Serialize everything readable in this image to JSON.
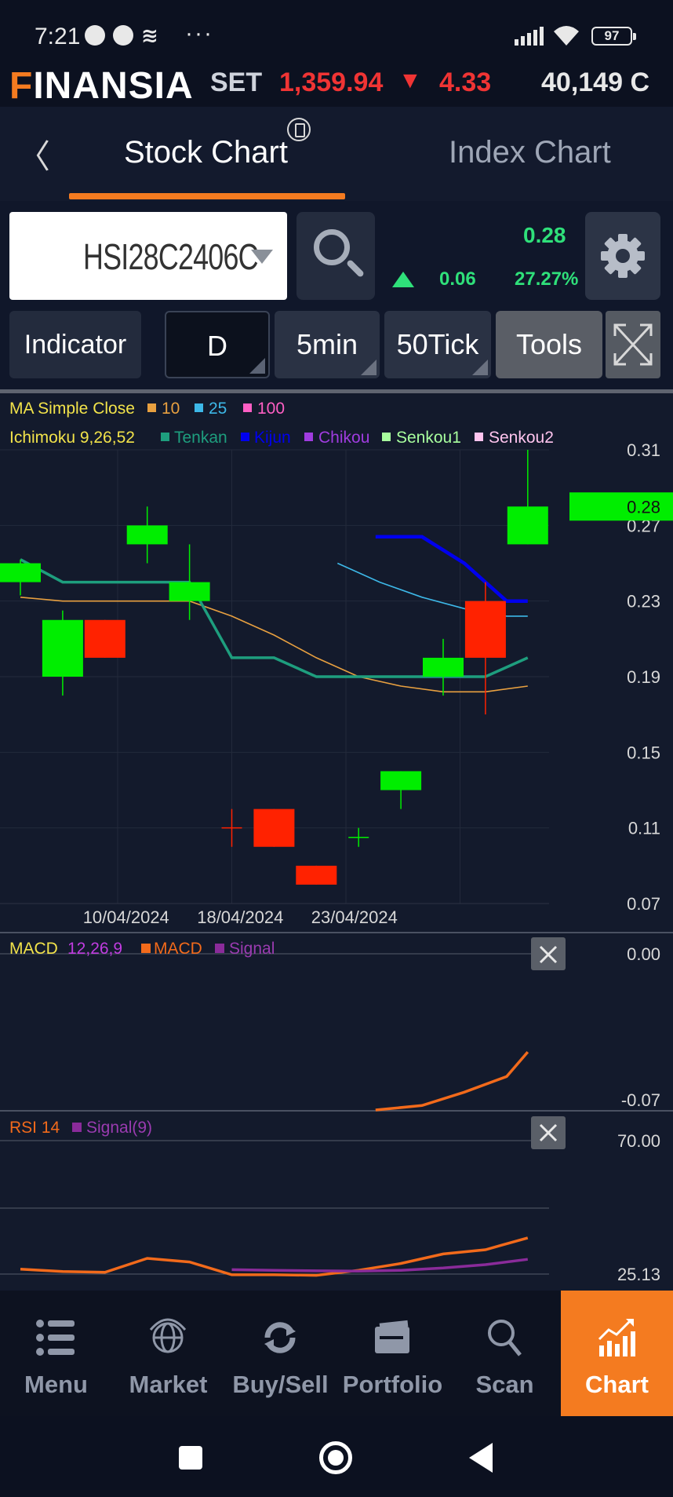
{
  "status_bar": {
    "time": "7:21",
    "icons": [
      "telegram-icon",
      "telegram-icon",
      "messenger-icon",
      "more-icon"
    ],
    "more": "···",
    "battery": "97"
  },
  "ticker": {
    "logo_first": "F",
    "logo_rest": "INANSIA",
    "market": "SET",
    "index": "1,359.94",
    "arrow": "▼",
    "change": "4.33",
    "volume": "40,149  C"
  },
  "tabs": {
    "back": "〈",
    "active": "Stock Chart",
    "inactive": "Index Chart"
  },
  "symbol": {
    "code": "HSI28C2406C",
    "last": "0.28",
    "change": "0.06",
    "percent": "27.27%"
  },
  "toolbar": {
    "indicator": "Indicator",
    "period_d": "D",
    "period_5min": "5min",
    "period_50tick": "50Tick",
    "tools": "Tools"
  },
  "colors": {
    "accent": "#f47b20",
    "up": "#00ee00",
    "down": "#ff2200",
    "tenkan": "#1e9e7e",
    "kijun": "#0000ee",
    "ma10": "#e8a040",
    "ma25": "#3db8e8",
    "macd": "#f26a1b",
    "signal": "#8a2b9a"
  },
  "chart_data": [
    {
      "type": "candlestick",
      "title": "",
      "legend_ma": {
        "name": "MA Simple Close",
        "items": [
          "10",
          "25",
          "100"
        ]
      },
      "legend_ichimoku": {
        "name": "Ichimoku 9,26,52",
        "items": [
          "Tenkan",
          "Kijun",
          "Chikou",
          "Senkou1",
          "Senkou2"
        ]
      },
      "x_ticks": [
        "10/04/2024",
        "18/04/2024",
        "23/04/2024"
      ],
      "y_ticks": [
        "0.31",
        "0.27",
        "0.23",
        "0.19",
        "0.15",
        "0.11",
        "0.07"
      ],
      "ylim": [
        0.07,
        0.31
      ],
      "last_price_label": "0.28",
      "candles": [
        {
          "o": 0.24,
          "c": 0.25,
          "h": 0.252,
          "l": 0.233
        },
        {
          "o": 0.19,
          "c": 0.22,
          "h": 0.225,
          "l": 0.18
        },
        {
          "o": 0.22,
          "c": 0.2,
          "h": 0.22,
          "l": 0.2
        },
        {
          "o": 0.26,
          "c": 0.27,
          "h": 0.28,
          "l": 0.25
        },
        {
          "o": 0.23,
          "c": 0.24,
          "h": 0.26,
          "l": 0.22
        },
        {
          "o": null,
          "c": null,
          "h": 0.12,
          "l": 0.1
        },
        {
          "o": 0.12,
          "c": 0.1,
          "h": 0.12,
          "l": 0.1
        },
        {
          "o": 0.09,
          "c": 0.08,
          "h": 0.09,
          "l": 0.08
        },
        {
          "o": null,
          "c": null,
          "h": 0.11,
          "l": 0.1
        },
        {
          "o": 0.13,
          "c": 0.14,
          "h": 0.14,
          "l": 0.12
        },
        {
          "o": 0.19,
          "c": 0.2,
          "h": 0.21,
          "l": 0.18
        },
        {
          "o": 0.23,
          "c": 0.2,
          "h": 0.24,
          "l": 0.17
        },
        {
          "o": 0.26,
          "c": 0.28,
          "h": 0.31,
          "l": 0.26
        }
      ],
      "tenkan": [
        [
          0,
          0.252
        ],
        [
          1,
          0.24
        ],
        [
          2,
          0.24
        ],
        [
          3,
          0.24
        ],
        [
          4,
          0.24
        ],
        [
          5,
          0.2
        ],
        [
          6,
          0.2
        ],
        [
          7,
          0.19
        ],
        [
          8,
          0.19
        ],
        [
          9,
          0.19
        ],
        [
          10,
          0.19
        ],
        [
          11,
          0.19
        ],
        [
          12,
          0.2
        ]
      ],
      "kijun": [
        [
          8.4,
          0.264
        ],
        [
          9.5,
          0.264
        ],
        [
          10.5,
          0.25
        ],
        [
          11.5,
          0.23
        ],
        [
          12,
          0.23
        ]
      ],
      "ma10": [
        [
          0,
          0.232
        ],
        [
          1,
          0.23
        ],
        [
          2,
          0.23
        ],
        [
          3,
          0.23
        ],
        [
          4,
          0.23
        ],
        [
          5,
          0.222
        ],
        [
          6,
          0.212
        ],
        [
          7,
          0.2
        ],
        [
          8,
          0.19
        ],
        [
          9,
          0.185
        ],
        [
          10,
          0.182
        ],
        [
          11,
          0.182
        ],
        [
          12,
          0.185
        ]
      ],
      "ma25": [
        [
          7.5,
          0.25
        ],
        [
          8.5,
          0.24
        ],
        [
          9.5,
          0.232
        ],
        [
          10.5,
          0.226
        ],
        [
          11.5,
          0.222
        ],
        [
          12,
          0.222
        ]
      ]
    },
    {
      "type": "line",
      "title": "",
      "legend": {
        "name": "MACD",
        "params": "12,26,9",
        "items": [
          "MACD",
          "Signal"
        ]
      },
      "y_ticks": [
        "0.00",
        "-0.07"
      ],
      "ylim": [
        -0.07,
        0.0
      ],
      "series": [
        {
          "name": "MACD",
          "points": [
            [
              8.4,
              -0.07
            ],
            [
              9.5,
              -0.068
            ],
            [
              10.5,
              -0.062
            ],
            [
              11.5,
              -0.055
            ],
            [
              12,
              -0.044
            ]
          ]
        }
      ]
    },
    {
      "type": "line",
      "title": "",
      "legend": {
        "name": "RSI 14",
        "items": [
          "Signal(9)"
        ]
      },
      "y_ticks": [
        "70.00",
        "25.13"
      ],
      "ylim": [
        25.13,
        70.0
      ],
      "series": [
        {
          "name": "RSI",
          "points": [
            [
              0,
              26.8
            ],
            [
              1,
              26
            ],
            [
              2,
              25.7
            ],
            [
              3,
              30.4
            ],
            [
              4,
              29.2
            ],
            [
              5,
              24.9
            ],
            [
              6,
              24.9
            ],
            [
              7,
              24.7
            ],
            [
              8,
              26.4
            ],
            [
              9,
              28.7
            ],
            [
              10,
              31.9
            ],
            [
              11,
              33.3
            ],
            [
              12,
              37.3
            ]
          ]
        },
        {
          "name": "Signal(9)",
          "points": [
            [
              5,
              26.6
            ],
            [
              6,
              26.4
            ],
            [
              7,
              26.2
            ],
            [
              8,
              26.1
            ],
            [
              9,
              26.4
            ],
            [
              10,
              27.2
            ],
            [
              11,
              28.3
            ],
            [
              12,
              30.1
            ]
          ]
        }
      ]
    }
  ],
  "nav": [
    {
      "label": "Menu",
      "icon": "menu-icon"
    },
    {
      "label": "Market",
      "icon": "globe-icon"
    },
    {
      "label": "Buy/Sell",
      "icon": "exchange-icon"
    },
    {
      "label": "Portfolio",
      "icon": "wallet-icon"
    },
    {
      "label": "Scan",
      "icon": "search-icon"
    },
    {
      "label": "Chart",
      "icon": "chart-icon"
    }
  ]
}
